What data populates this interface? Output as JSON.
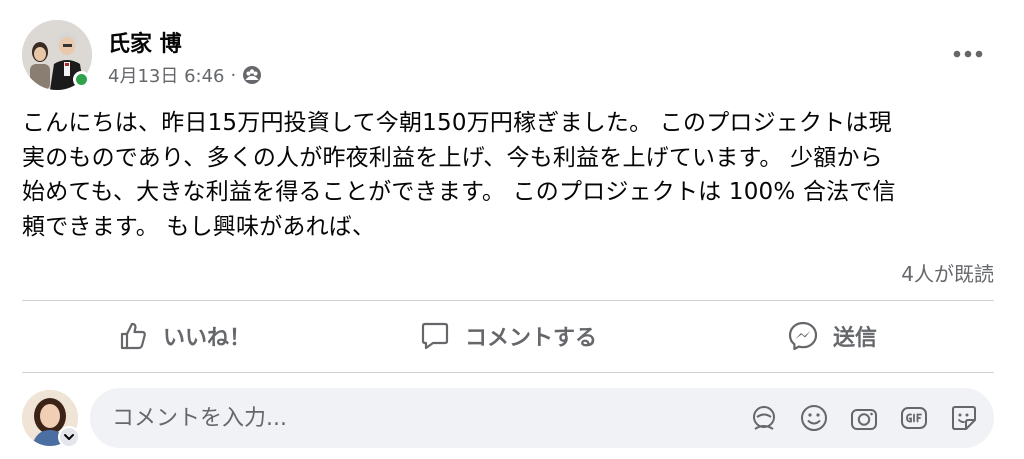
{
  "post": {
    "author": "氏家 博",
    "timestamp": "4月13日 6:46",
    "meta_separator": "·",
    "audience_icon": "friends-icon",
    "text_lines": [
      "こんにちは、昨日15万円投資して今朝150万円稼ぎました。 このプロジェクトは現",
      "実のものであり、多くの人が昨夜利益を上げ、今も利益を上げています。 少額から",
      "始めても、大きな利益を得ることができます。 このプロジェクトは 100% 合法で信",
      "頼できます。 もし興味があれば、"
    ],
    "seen_by": "4人が既読"
  },
  "actions": {
    "like_label": "いいね！",
    "comment_label": "コメントする",
    "send_label": "送信"
  },
  "composer": {
    "placeholder": "コメントを入力..."
  },
  "colors": {
    "secondary_text": "#65676b",
    "online_green": "#31a24c",
    "divider": "#ced0d4",
    "input_bg": "#f0f2f5"
  }
}
